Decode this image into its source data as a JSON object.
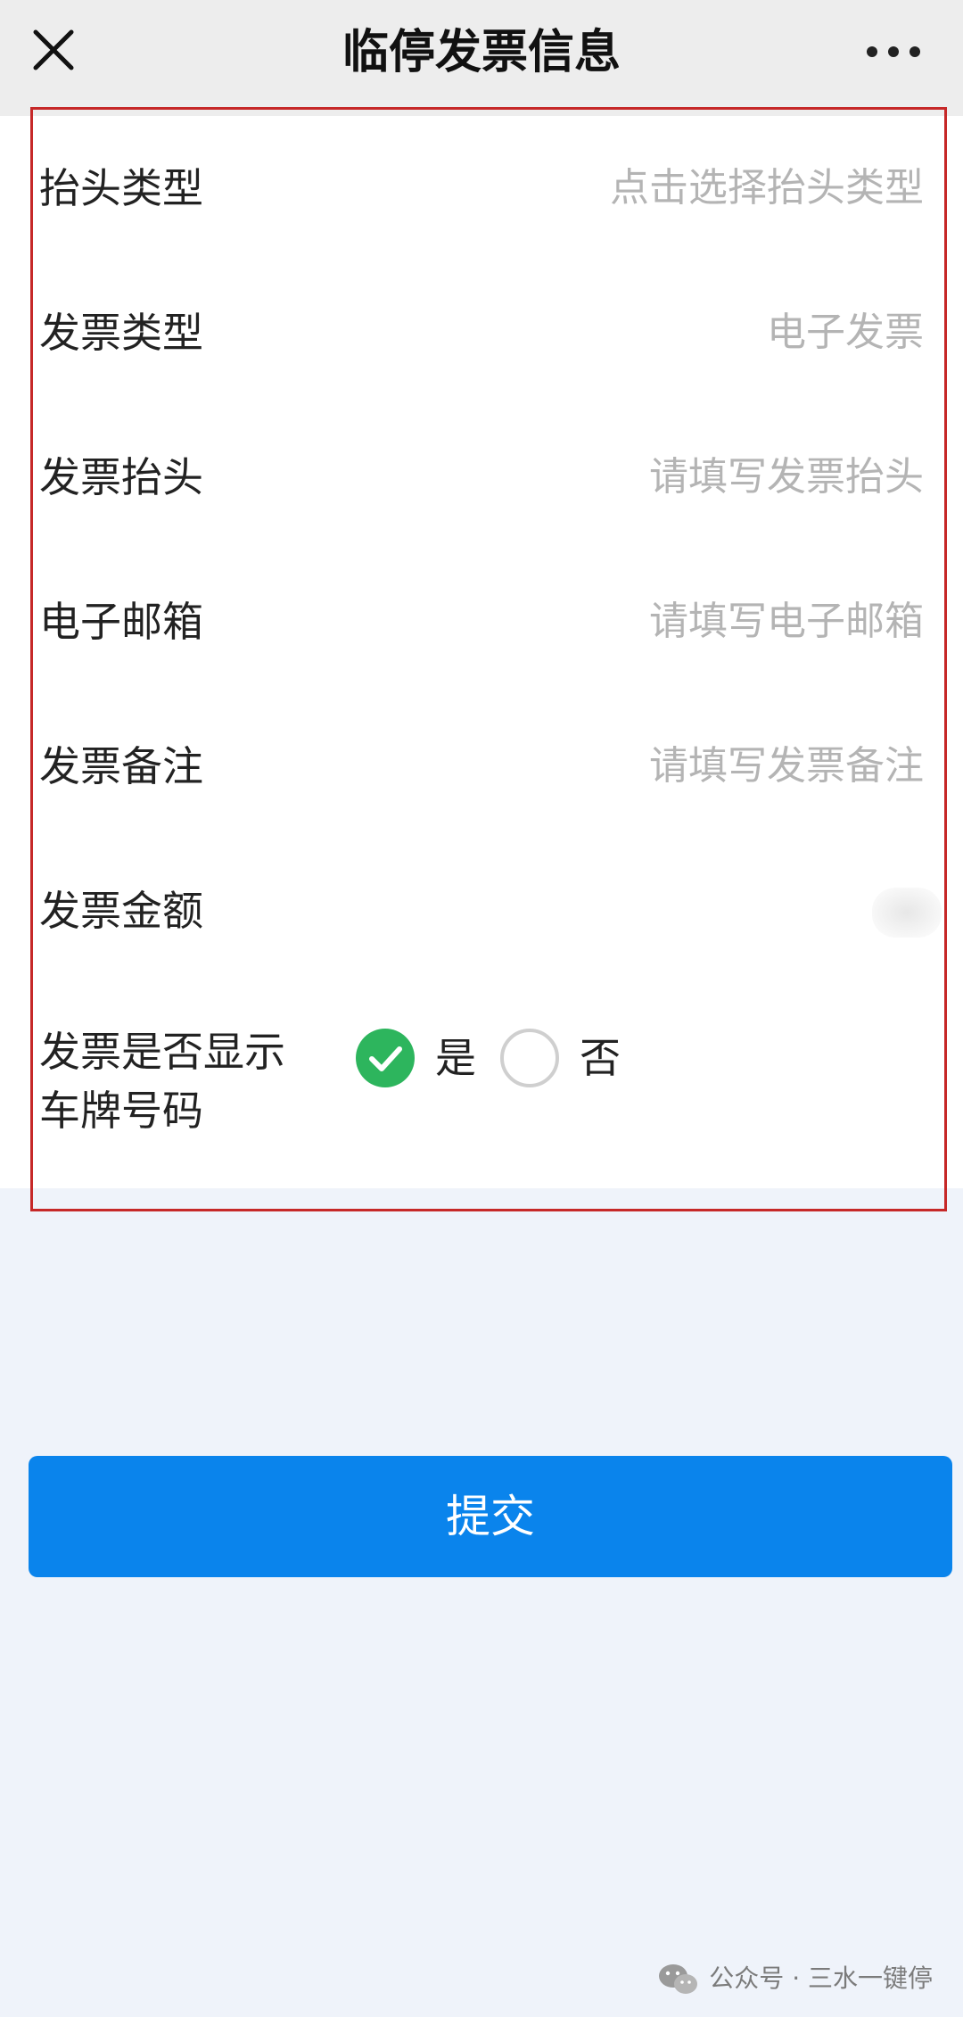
{
  "header": {
    "title": "临停发票信息",
    "close_icon": "close-icon",
    "more_icon": "more-dots-icon"
  },
  "form": {
    "rows": [
      {
        "label": "抬头类型",
        "value": "点击选择抬头类型"
      },
      {
        "label": "发票类型",
        "value": "电子发票"
      },
      {
        "label": "发票抬头",
        "value": "请填写发票抬头"
      },
      {
        "label": "电子邮箱",
        "value": "请填写电子邮箱"
      },
      {
        "label": "发票备注",
        "value": "请填写发票备注"
      },
      {
        "label": "发票金额",
        "value": ""
      }
    ],
    "plate_question": {
      "line1": "发票是否显示",
      "line2": "车牌号码"
    },
    "options": {
      "yes": "是",
      "no": "否",
      "selected": "yes"
    }
  },
  "submit_label": "提交",
  "watermark": "公众号 · 三水一键停",
  "colors": {
    "accent": "#0a84ec",
    "check_green": "#2db55d",
    "highlight_border": "#c62828"
  }
}
